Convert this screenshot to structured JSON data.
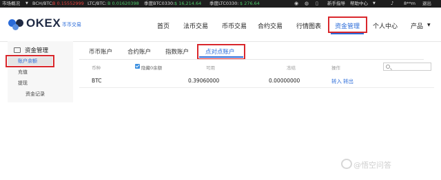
{
  "ticker": {
    "market_label": "市场概况",
    "bch_pair": "BCH/BTC:",
    "bch_price": "B 0.15552999",
    "ltc_pair": "LTC/BTC:",
    "ltc_price": "B 0.01620398",
    "btc_q_label": "季度BTC0330:",
    "btc_q_price": "$ 16,214.64",
    "ltc_q_label": "季度LTC0330:",
    "ltc_q_price": "$ 276.64",
    "guide": "新手指导",
    "help": "帮助中心",
    "user": "8**m",
    "logout": "退出",
    "colors": {
      "up": "#4cc96a",
      "down": "#e8413d"
    }
  },
  "header": {
    "logo_text": "OKEX",
    "logo_sub": "币币交易",
    "nav": [
      "首页",
      "法币交易",
      "币币交易",
      "合约交易",
      "行情图表",
      "资金管理",
      "个人中心",
      "产品"
    ],
    "active_nav": "资金管理"
  },
  "sidebar": {
    "heading": "资金管理",
    "items": [
      "账户余额",
      "充值",
      "提现",
      "资金记录"
    ],
    "active_item": "账户余额"
  },
  "tabs": {
    "items": [
      "币币账户",
      "合约账户",
      "指数账户",
      "点对点账户"
    ],
    "active": "点对点账户"
  },
  "table": {
    "headers": {
      "currency": "币种",
      "hide_zero": "隐藏0余额",
      "available": "可用",
      "frozen": "冻结",
      "actions": "操作"
    },
    "search_placeholder": "",
    "rows": [
      {
        "currency": "BTC",
        "available": "0.39060000",
        "frozen": "0.00000000",
        "action_in": "转入",
        "action_out": "转出"
      }
    ]
  },
  "watermark": "@悟空问答",
  "accent": {
    "blue": "#2a6bd9",
    "highlight_red": "#d9262b"
  }
}
